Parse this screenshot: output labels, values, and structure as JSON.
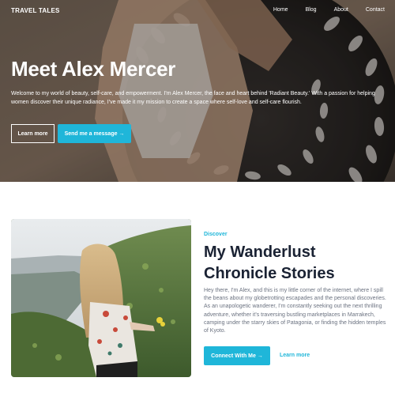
{
  "nav": {
    "brand": "TRAVEL TALES",
    "links": [
      "Home",
      "Blog",
      "About",
      "Contact"
    ]
  },
  "hero": {
    "title": "Meet Alex Mercer",
    "text": "Welcome to my world of beauty, self-care, and empowerment. I'm Alex Mercer, the face and heart behind 'Radiant Beauty.' With a passion for helping women discover their unique radiance, I've made it my mission to create a space where self-love and self-care flourish.",
    "learn_more": "Learn more",
    "message_button": "Send me a message →"
  },
  "about": {
    "eyebrow": "Discover",
    "title": "My Wanderlust Chronicle Stories",
    "text": "Hey there, I'm Alex, and this is my little corner of the internet, where I spill the beans about my globetrotting escapades and the personal discoveries. As an unapologetic wanderer, I'm constantly seeking out the next thrilling adventure, whether it's traversing bustling marketplaces in Marrakech, camping under the starry skies of Patagonia, or finding the hidden temples of Kyoto.",
    "connect_button": "Connect With Me →",
    "learn_more": "Learn more"
  },
  "colors": {
    "accent": "#1fb6d9",
    "heading": "#1a2233",
    "body_text": "#6b7280"
  }
}
